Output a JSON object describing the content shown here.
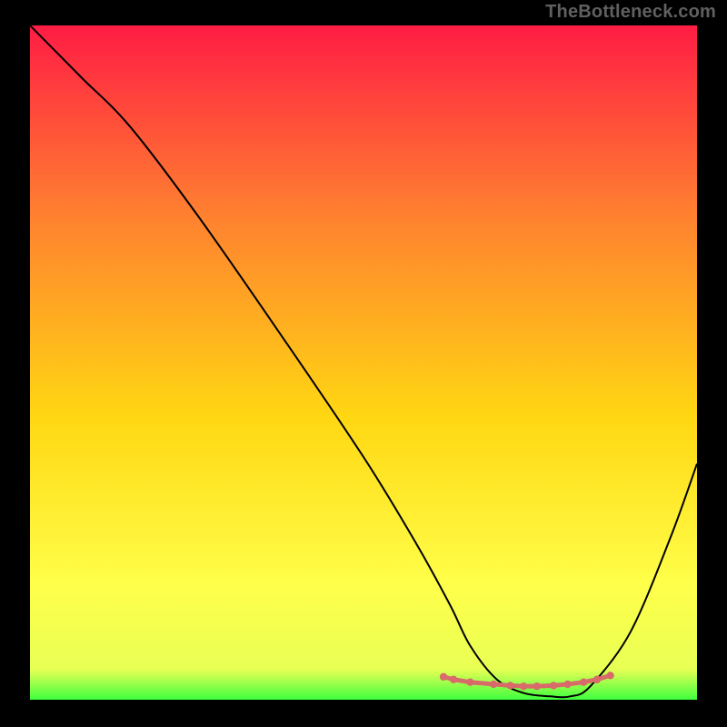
{
  "watermark": "TheBottleneck.com",
  "colors": {
    "background": "#000000",
    "gradient_top": "#ff1c44",
    "gradient_upper_mid": "#ff8030",
    "gradient_mid": "#ffd712",
    "gradient_lower_mid": "#ffff4a",
    "gradient_green": "#3fff3f",
    "curve_stroke": "#000000",
    "marker_stroke": "#d86a6a",
    "marker_fill": "#d86a6a"
  },
  "chart_data": {
    "type": "line",
    "title": "",
    "xlabel": "",
    "ylabel": "",
    "xlim": [
      0,
      100
    ],
    "ylim": [
      0,
      100
    ],
    "gradient_stops": [
      {
        "offset": 0,
        "color": "#ff1c44"
      },
      {
        "offset": 28,
        "color": "#ff8030"
      },
      {
        "offset": 58,
        "color": "#ffd712"
      },
      {
        "offset": 83,
        "color": "#ffff4a"
      },
      {
        "offset": 95.5,
        "color": "#e8ff54"
      },
      {
        "offset": 100,
        "color": "#3fff3f"
      }
    ],
    "series": [
      {
        "name": "bottleneck-curve",
        "type": "line",
        "x": [
          0,
          4,
          8,
          15,
          25,
          37,
          50,
          58,
          63,
          66,
          70,
          74,
          78,
          81,
          84,
          90,
          96,
          100
        ],
        "y": [
          100,
          96,
          92,
          85,
          72,
          55,
          36,
          23,
          14,
          8,
          3,
          1,
          0.5,
          0.5,
          2,
          10,
          24,
          35
        ]
      }
    ],
    "markers": {
      "name": "highlight-region",
      "type": "scatter",
      "x": [
        62,
        63.5,
        66,
        69.5,
        72,
        74,
        76,
        78.5,
        80.6,
        83,
        85,
        87
      ],
      "y": [
        3.4,
        3.0,
        2.6,
        2.3,
        2.1,
        2.0,
        2.0,
        2.1,
        2.3,
        2.6,
        3.0,
        3.6
      ]
    }
  }
}
